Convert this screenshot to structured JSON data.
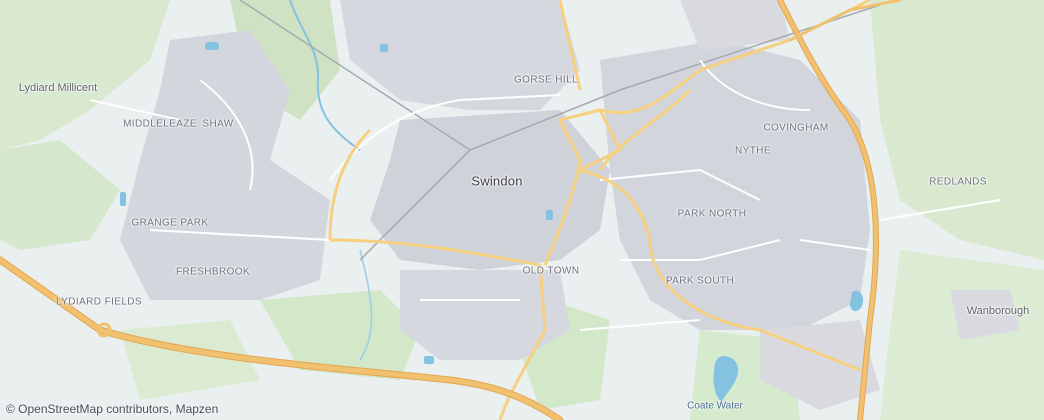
{
  "colors": {
    "background": "#eaeff0",
    "urban": "#d4d6de",
    "woodland": "#cfe3c4",
    "park": "#d3e8c9",
    "water": "#83c2e0",
    "motorway": "#f1c170",
    "motorway_casing": "#e3a650",
    "primary_road": "#f6d07f",
    "minor_road": "#ffffff",
    "railway": "#a6aab0"
  },
  "labels": {
    "city": "Swindon",
    "districts": {
      "gorse_hill": "GORSE HILL",
      "middleleaze": "MIDDLELEAZE",
      "shaw": "SHAW",
      "covingham": "COVINGHAM",
      "nythe": "NYTHE",
      "redlands": "REDLANDS",
      "grange_park": "GRANGE PARK",
      "park_north": "PARK NORTH",
      "freshbrook": "FRESHBROOK",
      "old_town": "OLD TOWN",
      "park_south": "PARK SOUTH",
      "lydiard_fields": "LYDIARD FIELDS"
    },
    "villages": {
      "lydiard_millicent": "Lydiard Millicent",
      "wanborough": "Wanborough"
    },
    "water": {
      "coate_water": "Coate Water"
    }
  },
  "attribution": "© OpenStreetMap contributors, Mapzen"
}
